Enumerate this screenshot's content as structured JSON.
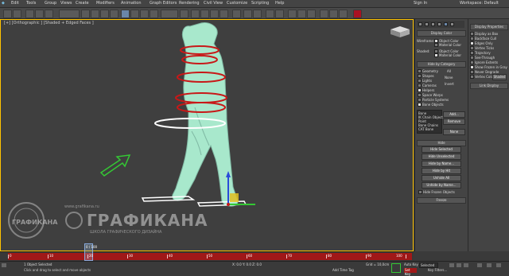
{
  "menubar": {
    "items": [
      "Edit",
      "Tools",
      "Group",
      "Views",
      "Create",
      "Modifiers",
      "Animation",
      "Graph Editors",
      "Rendering",
      "Civil View",
      "Customize",
      "Scripting",
      "Help"
    ],
    "workspace_label": "Workspace: Default",
    "user_label": "Sign In"
  },
  "viewport": {
    "label": "[+] [Orthographic ] [Shaded + Edged Faces ]",
    "watermark_title": "ГРАФИКАНА",
    "watermark_sub": "ШКОЛА ГРАФИЧЕСКОГО ДИЗАЙНА",
    "watermark_url": "www.grafikana.ru",
    "logo_text": "ГРАФИКАНА",
    "colors": {
      "gizmo_red": "#c81818",
      "ring_white": "#ffffff",
      "body": "#a8e8cc",
      "arrow": "#34c834"
    }
  },
  "cmd_panel": {
    "display_color_title": "Display Color",
    "wireframe_label": "Wireframe:",
    "shaded_label": "Shaded:",
    "object_color": "Object Color",
    "material_color": "Material Color",
    "hide_by_category_title": "Hide by Category",
    "categories": [
      "Geometry",
      "Shapes",
      "Lights",
      "Cameras",
      "Helpers",
      "Space Warps",
      "Particle Systems",
      "Bone Objects"
    ],
    "all_btn": "All",
    "none_btn": "None",
    "invert_btn": "Invert",
    "list_items": [
      "Bone",
      "IK Chain Object",
      "Point",
      "Bone Chains",
      "CAT Bone"
    ],
    "add_btn": "Add...",
    "remove_btn": "Remove",
    "none2_btn": "None",
    "hide_title": "Hide",
    "hide_buttons": [
      "Hide Selected",
      "Hide Unselected",
      "Hide by Name...",
      "Hide by Hit",
      "Unhide All",
      "Unhide by Name..."
    ],
    "hide_frozen": "Hide Frozen Objects",
    "freeze_title": "Freeze"
  },
  "disp_panel": {
    "title": "Display Properties",
    "options": [
      "Display as Box",
      "Backface Cull",
      "Edges Only",
      "Vertex Ticks",
      "Trajectory",
      "See-Through",
      "Ignore Extents",
      "Show Frozen in Gray",
      "Never Degrade",
      "Vertex Colors"
    ],
    "shaded_btn": "Shaded",
    "link_title": "Link Display"
  },
  "timeline": {
    "frame_counter": "0 / 100",
    "ticks": [
      "0",
      "10",
      "20",
      "30",
      "40",
      "50",
      "60",
      "70",
      "80",
      "90",
      "100"
    ]
  },
  "status": {
    "objects_selected": "1 Object Selected",
    "prompt": "Click and drag to select and move objects",
    "coords": "X: 0.0  Y: 0.0  Z: 0.0",
    "grid": "Grid = 10,0cm",
    "auto_key": "Auto Key",
    "selected_label": "Selected",
    "set_key": "Set Key",
    "key_filters": "Key Filters...",
    "add_time_tag": "Add Time Tag"
  }
}
